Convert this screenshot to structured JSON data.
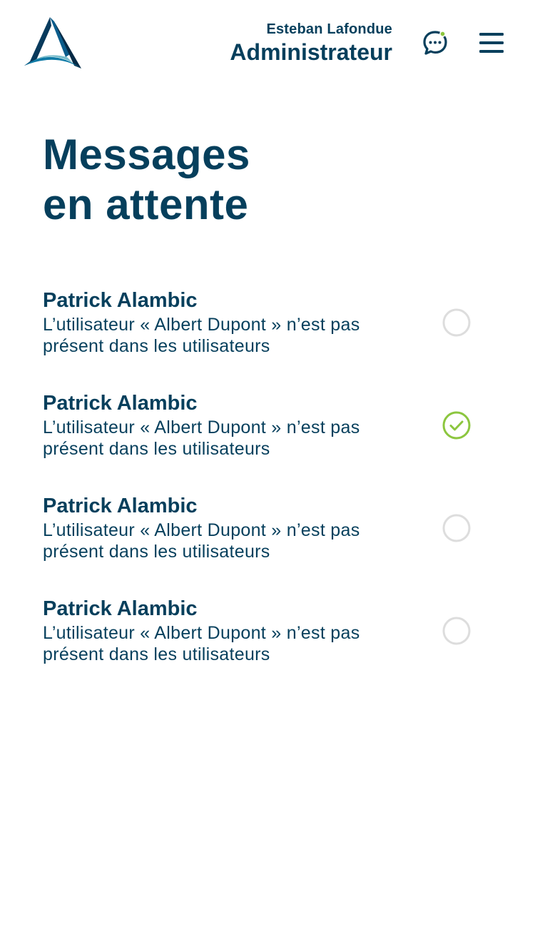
{
  "header": {
    "user_name": "Esteban Lafondue",
    "user_role": "Administrateur",
    "chat_icon": "chat-bubble-icon",
    "menu_icon": "hamburger-menu-icon",
    "notification_dot_color": "#8cc63f"
  },
  "page": {
    "title_line1": "Messages",
    "title_line2": "en attente"
  },
  "messages": [
    {
      "author": "Patrick Alambic",
      "text": "L’utilisateur « Albert Dupont » n’est pas présent dans les utilisateurs",
      "checked": false
    },
    {
      "author": "Patrick Alambic",
      "text": "L’utilisateur « Albert Dupont » n’est pas présent dans les utilisateurs",
      "checked": true
    },
    {
      "author": "Patrick Alambic",
      "text": "L’utilisateur « Albert Dupont » n’est pas présent dans les utilisateurs",
      "checked": false
    },
    {
      "author": "Patrick Alambic",
      "text": "L’utilisateur « Albert Dupont » n’est pas présent dans les utilisateurs",
      "checked": false
    }
  ],
  "colors": {
    "primary": "#063f5c",
    "accent_green": "#8cc63f",
    "unchecked_ring": "#dddddd"
  }
}
